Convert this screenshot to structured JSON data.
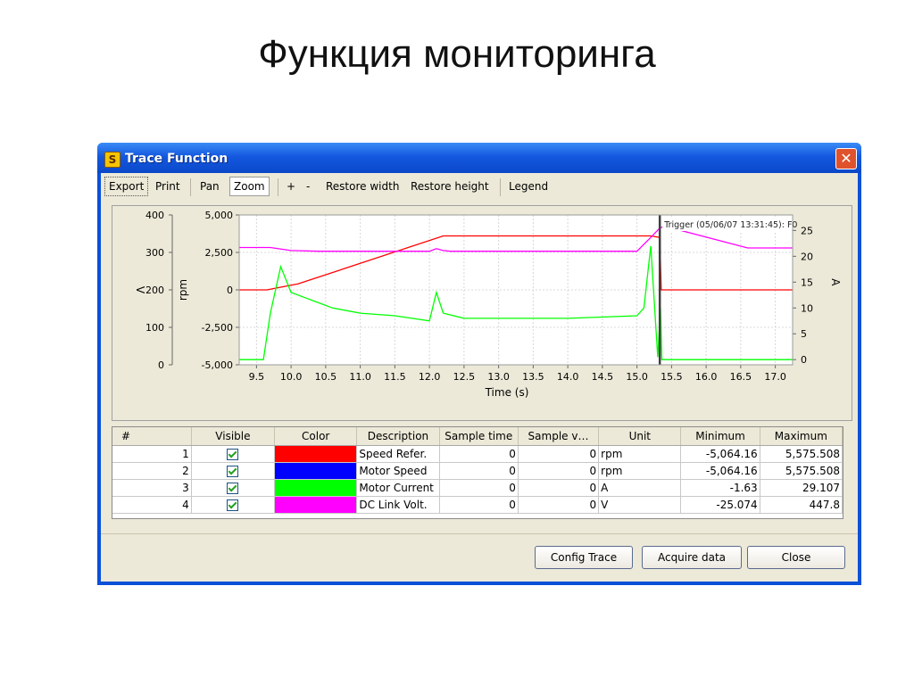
{
  "slide": {
    "title": "Функция мониторинга"
  },
  "window": {
    "title": "Trace Function",
    "app_icon": "S",
    "close_glyph": "✕"
  },
  "toolbar": {
    "export": "Export",
    "print": "Print",
    "pan": "Pan",
    "zoom": "Zoom",
    "plus": "+",
    "minus": "-",
    "restore_width": "Restore width",
    "restore_height": "Restore height",
    "legend": "Legend"
  },
  "colors": {
    "speed_ref": "#ff0000",
    "motor_speed": "#0000ff",
    "motor_current": "#00ff00",
    "dc_link": "#ff00ff",
    "trigger": "#404040"
  },
  "chart_data": {
    "type": "line",
    "xlabel": "Time (s)",
    "x_ticks": [
      "9.5",
      "10.0",
      "10.5",
      "11.0",
      "11.5",
      "12.0",
      "12.5",
      "13.0",
      "13.5",
      "14.0",
      "14.5",
      "15.0",
      "15.5",
      "16.0",
      "16.5",
      "17.0"
    ],
    "xlim": [
      9.25,
      17.25
    ],
    "axes": {
      "v": {
        "label": "V",
        "ticks": [
          "400",
          "300",
          "200",
          "100",
          "0"
        ],
        "range": [
          0,
          400
        ]
      },
      "rpm": {
        "label": "rpm",
        "ticks": [
          "5,000",
          "2,500",
          "0",
          "-2,500",
          "-5,000"
        ],
        "range": [
          -5000,
          5000
        ]
      },
      "a": {
        "label": "A",
        "ticks": [
          "25",
          "20",
          "15",
          "10",
          "5",
          "0"
        ],
        "range": [
          -1,
          28
        ]
      }
    },
    "trigger_x": 15.33,
    "trigger_label": "Trigger (05/06/07 13:31:45): F0",
    "series": [
      {
        "name": "Speed Refer.",
        "axis": "rpm",
        "x": [
          9.25,
          9.65,
          10.1,
          12.2,
          15.2,
          15.33,
          15.35,
          17.25
        ],
        "y": [
          0,
          0,
          400,
          3600,
          3600,
          3500,
          0,
          0
        ]
      },
      {
        "name": "DC Link Volt.",
        "axis": "v",
        "x": [
          9.25,
          9.7,
          10.0,
          10.4,
          11.0,
          12.0,
          12.1,
          12.2,
          12.3,
          13.0,
          14.0,
          15.0,
          15.2,
          15.33,
          15.4,
          16.6,
          17.25
        ],
        "y": [
          313,
          313,
          305,
          303,
          303,
          303,
          310,
          305,
          303,
          303,
          303,
          303,
          340,
          365,
          370,
          312,
          312
        ]
      },
      {
        "name": "Motor Current",
        "axis": "a",
        "x": [
          9.25,
          9.6,
          9.7,
          9.85,
          10.0,
          10.2,
          10.4,
          10.6,
          10.8,
          11.0,
          11.5,
          12.0,
          12.1,
          12.2,
          12.5,
          13.0,
          14.0,
          15.0,
          15.1,
          15.2,
          15.3,
          15.34,
          15.36,
          17.25
        ],
        "y": [
          0,
          0,
          9,
          18,
          13,
          12,
          11,
          10,
          9.5,
          9,
          8.5,
          7.5,
          13,
          9,
          8,
          8,
          8,
          8.5,
          10,
          22,
          0.5,
          10,
          0,
          0
        ]
      },
      {
        "name": "Motor Speed",
        "axis": "rpm",
        "x": [],
        "y": []
      }
    ]
  },
  "table": {
    "headers": [
      "#",
      "Visible",
      "Color",
      "Description",
      "Sample time",
      "Sample v…",
      "Unit",
      "Minimum",
      "Maximum"
    ],
    "rows": [
      {
        "n": "1",
        "visible": true,
        "color": "#ff0000",
        "desc": "Speed Refer.",
        "stime": "0",
        "sval": "0",
        "unit": "rpm",
        "min": "-5,064.16",
        "max": "5,575.508"
      },
      {
        "n": "2",
        "visible": true,
        "color": "#0000ff",
        "desc": "Motor Speed",
        "stime": "0",
        "sval": "0",
        "unit": "rpm",
        "min": "-5,064.16",
        "max": "5,575.508"
      },
      {
        "n": "3",
        "visible": true,
        "color": "#00ff00",
        "desc": "Motor Current",
        "stime": "0",
        "sval": "0",
        "unit": "A",
        "min": "-1.63",
        "max": "29.107"
      },
      {
        "n": "4",
        "visible": true,
        "color": "#ff00ff",
        "desc": "DC Link Volt.",
        "stime": "0",
        "sval": "0",
        "unit": "V",
        "min": "-25.074",
        "max": "447.8"
      }
    ]
  },
  "buttons": {
    "config": "Config Trace",
    "acquire": "Acquire data",
    "close": "Close"
  }
}
